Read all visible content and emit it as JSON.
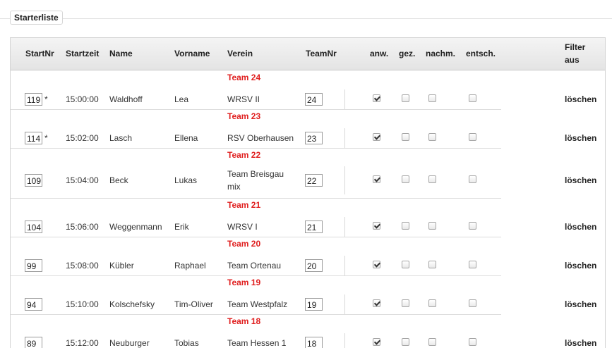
{
  "legend": "Starterliste",
  "headers": {
    "startnr": "StartNr",
    "startzeit": "Startzeit",
    "name": "Name",
    "vorname": "Vorname",
    "verein": "Verein",
    "teamnr": "TeamNr",
    "anw": "anw.",
    "gez": "gez.",
    "nachm": "nachm.",
    "entsch": "entsch.",
    "filter_line1": "Filter",
    "filter_line2": "aus"
  },
  "delete_label": "löschen",
  "rows": [
    {
      "team_label": "Team 24",
      "startnr": "119",
      "marker": "*",
      "startzeit": "15:00:00",
      "name": "Waldhoff",
      "vorname": "Lea",
      "verein_line1": "WRSV II",
      "verein_line2": "",
      "teamnr": "24",
      "anw": true,
      "gez": false,
      "nachm": false,
      "entsch": false
    },
    {
      "team_label": "Team 23",
      "startnr": "114",
      "marker": "*",
      "startzeit": "15:02:00",
      "name": "Lasch",
      "vorname": "Ellena",
      "verein_line1": "RSV Oberhausen",
      "verein_line2": "",
      "teamnr": "23",
      "anw": true,
      "gez": false,
      "nachm": false,
      "entsch": false
    },
    {
      "team_label": "Team 22",
      "startnr": "109",
      "marker": "",
      "startzeit": "15:04:00",
      "name": "Beck",
      "vorname": "Lukas",
      "verein_line1": "Team Breisgau",
      "verein_line2": "mix",
      "teamnr": "22",
      "anw": true,
      "gez": false,
      "nachm": false,
      "entsch": false
    },
    {
      "team_label": "Team 21",
      "startnr": "104",
      "marker": "",
      "startzeit": "15:06:00",
      "name": "Weggenmann",
      "vorname": "Erik",
      "verein_line1": "WRSV I",
      "verein_line2": "",
      "teamnr": "21",
      "anw": true,
      "gez": false,
      "nachm": false,
      "entsch": false
    },
    {
      "team_label": "Team 20",
      "startnr": "99",
      "marker": "",
      "startzeit": "15:08:00",
      "name": "Kübler",
      "vorname": "Raphael",
      "verein_line1": "Team Ortenau",
      "verein_line2": "",
      "teamnr": "20",
      "anw": true,
      "gez": false,
      "nachm": false,
      "entsch": false
    },
    {
      "team_label": "Team 19",
      "startnr": "94",
      "marker": "",
      "startzeit": "15:10:00",
      "name": "Kolschefsky",
      "vorname": "Tim-Oliver",
      "verein_line1": "Team Westpfalz",
      "verein_line2": "",
      "teamnr": "19",
      "anw": true,
      "gez": false,
      "nachm": false,
      "entsch": false
    },
    {
      "team_label": "Team 18",
      "startnr": "89",
      "marker": "",
      "startzeit": "15:12:00",
      "name": "Neuburger",
      "vorname": "Tobias",
      "verein_line1": "Team Hessen 1",
      "verein_line2": "",
      "teamnr": "18",
      "anw": true,
      "gez": false,
      "nachm": false,
      "entsch": false
    }
  ]
}
